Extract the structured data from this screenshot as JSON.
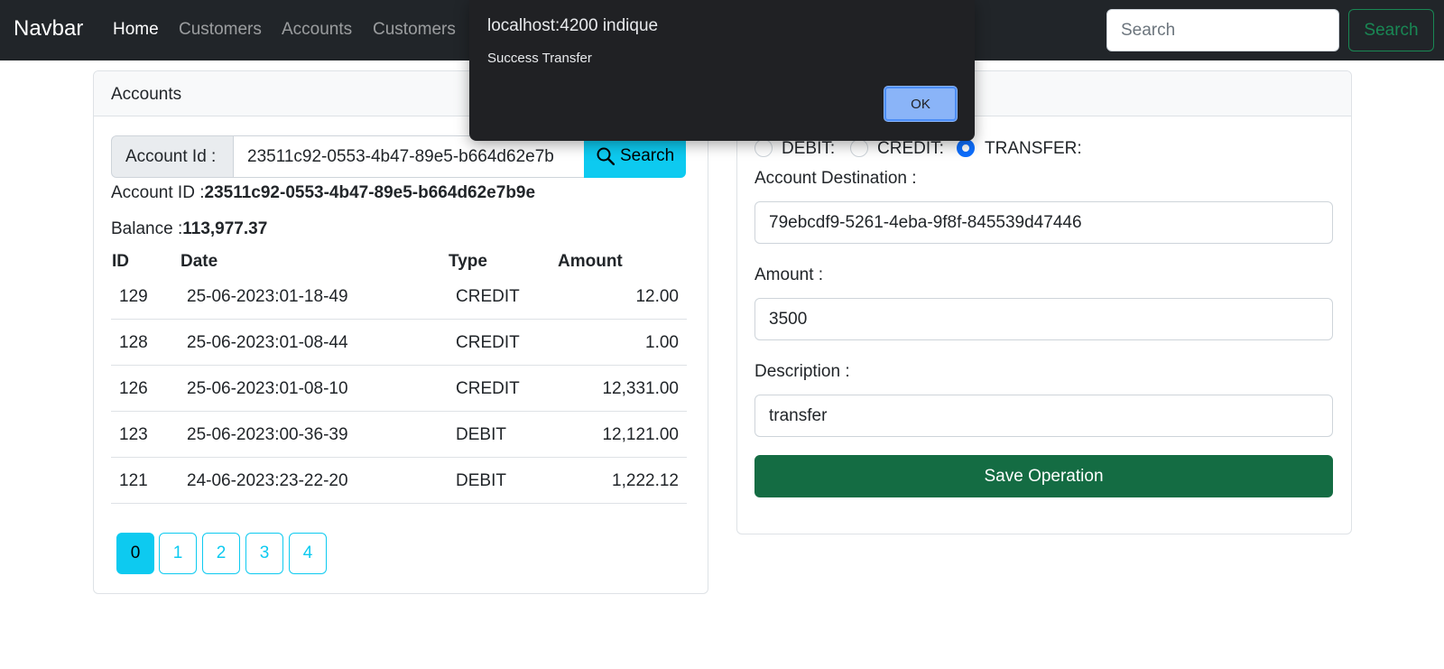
{
  "navbar": {
    "brand": "Navbar",
    "links": [
      "Home",
      "Customers",
      "Accounts",
      "Customers"
    ],
    "search_placeholder": "Search",
    "search_button": "Search"
  },
  "accounts_card": {
    "title": "Accounts",
    "account_id_label": "Account Id :",
    "account_id_input_value": "23511c92-0553-4b47-89e5-b664d62e7b",
    "search_button": "Search",
    "account_id_line_label": "Account ID :",
    "account_id_value": "23511c92-0553-4b47-89e5-b664d62e7b9e",
    "balance_label": "Balance :",
    "balance_value": "113,977.37",
    "table": {
      "headers": [
        "ID",
        "Date",
        "Type",
        "Amount"
      ],
      "rows": [
        {
          "id": "129",
          "date": "25-06-2023:01-18-49",
          "type": "CREDIT",
          "amount": "12.00"
        },
        {
          "id": "128",
          "date": "25-06-2023:01-08-44",
          "type": "CREDIT",
          "amount": "1.00"
        },
        {
          "id": "126",
          "date": "25-06-2023:01-08-10",
          "type": "CREDIT",
          "amount": "12,331.00"
        },
        {
          "id": "123",
          "date": "25-06-2023:00-36-39",
          "type": "DEBIT",
          "amount": "12,121.00"
        },
        {
          "id": "121",
          "date": "24-06-2023:23-22-20",
          "type": "DEBIT",
          "amount": "1,222.12"
        }
      ]
    },
    "pages": [
      "0",
      "1",
      "2",
      "3",
      "4"
    ],
    "active_page": "0"
  },
  "operation_form": {
    "radios": [
      {
        "label": "DEBIT:",
        "checked": false
      },
      {
        "label": "CREDIT:",
        "checked": false
      },
      {
        "label": "TRANSFER:",
        "checked": true
      }
    ],
    "destination_label": "Account Destination :",
    "destination_value": "79ebcdf9-5261-4eba-9f8f-845539d47446",
    "amount_label": "Amount :",
    "amount_value": "3500",
    "description_label": "Description :",
    "description_value": "transfer",
    "save_button": "Save Operation"
  },
  "dialog": {
    "title": "localhost:4200 indique",
    "message": "Success Transfer",
    "ok_button": "OK"
  },
  "colors": {
    "navbar_bg": "#212529",
    "info": "#0dcaf0",
    "success": "#146c43",
    "radio_checked": "#0d6efd",
    "dialog_bg": "#202124",
    "dialog_button": "#8ab4f8"
  }
}
